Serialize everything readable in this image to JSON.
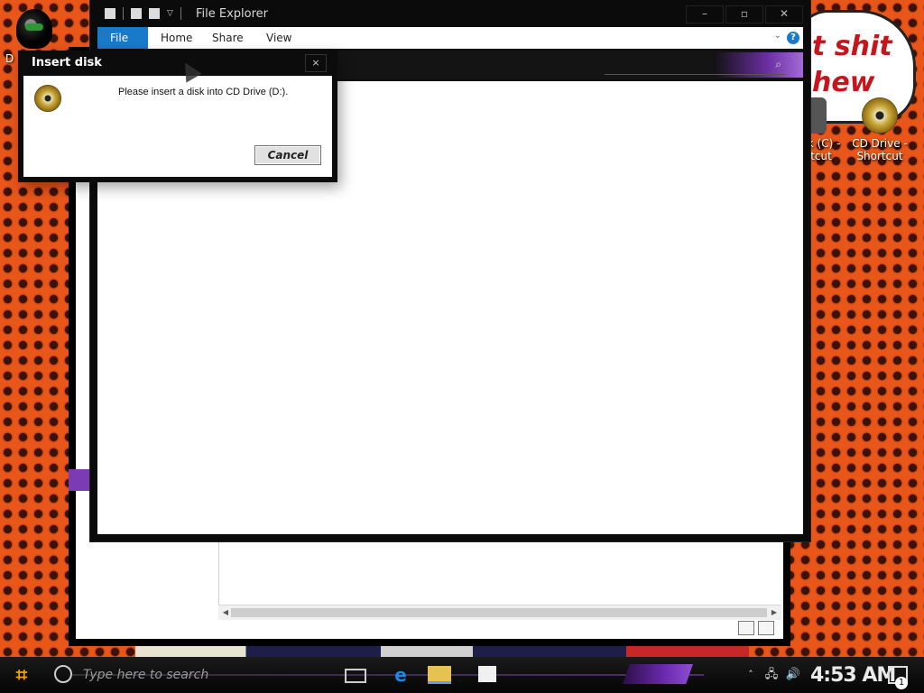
{
  "desktop": {
    "icons": [
      {
        "label_line1": "D",
        "label_line2": ""
      },
      {
        "label_line1": "sk (C) -",
        "label_line2": "tcut"
      },
      {
        "label_line1": "CD Drive -",
        "label_line2": "Shortcut"
      }
    ],
    "bubble_lines": [
      "t shit",
      "hew"
    ]
  },
  "explorer": {
    "title": "File Explorer",
    "tabs": [
      "File",
      "Home",
      "Share",
      "View"
    ],
    "help_label": "?"
  },
  "dialog": {
    "title": "Insert disk",
    "message": "Please insert a disk into CD Drive (D:).",
    "cancel_label": "Cancel",
    "close_label": "×"
  },
  "taskbar": {
    "search_placeholder": "Type here to search",
    "clock": "4:53 AM",
    "notification_count": "1"
  },
  "colors": {
    "accent_blue": "#1979ca",
    "purple_accent": "#7a3bb5",
    "wallpaper_orange": "#e8561a"
  }
}
